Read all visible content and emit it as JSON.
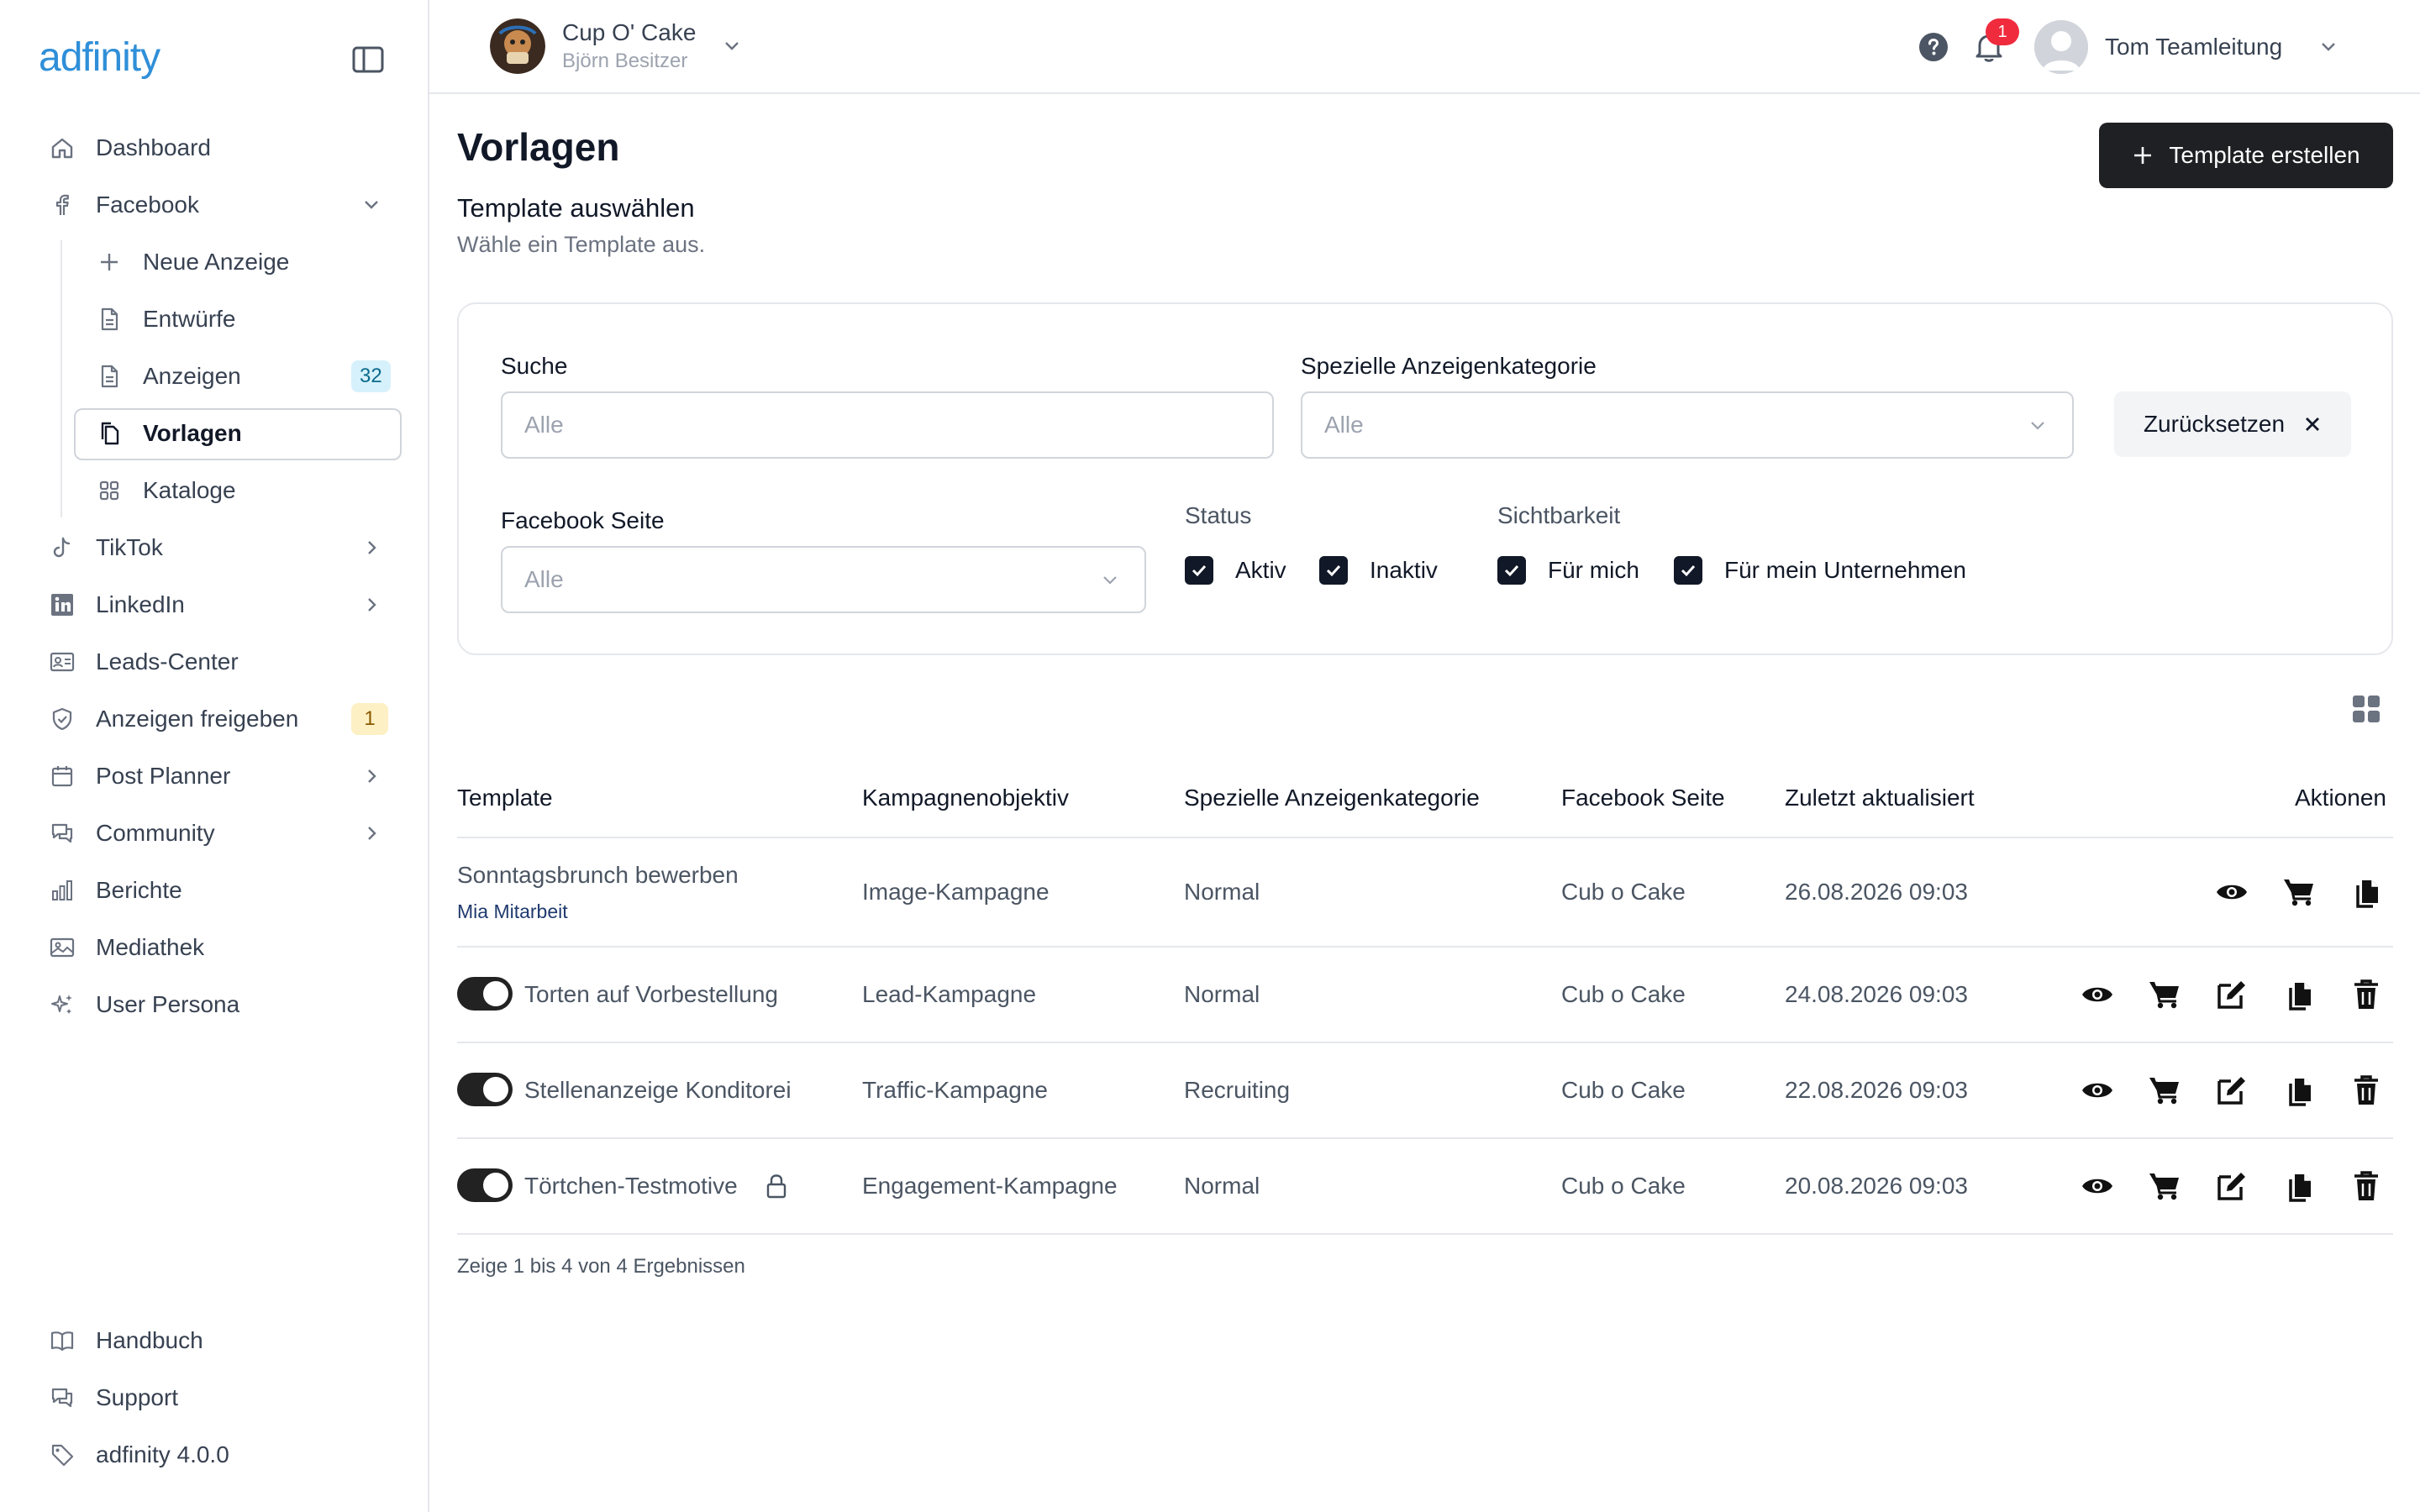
{
  "brand": {
    "logo_text": "adfinity",
    "accent": "#2f8fd8"
  },
  "sidebar": {
    "items": [
      {
        "label": "Dashboard",
        "icon": "home-icon"
      },
      {
        "label": "Facebook",
        "icon": "facebook-icon"
      },
      {
        "label": "Neue Anzeige",
        "icon": "plus-icon"
      },
      {
        "label": "Entwürfe",
        "icon": "document-icon"
      },
      {
        "label": "Anzeigen",
        "icon": "document-icon",
        "badge": "32"
      },
      {
        "label": "Vorlagen",
        "icon": "copy-icon"
      },
      {
        "label": "Kataloge",
        "icon": "grid-icon"
      },
      {
        "label": "TikTok",
        "icon": "tiktok-icon"
      },
      {
        "label": "LinkedIn",
        "icon": "linkedin-icon"
      },
      {
        "label": "Leads-Center",
        "icon": "id-card-icon"
      },
      {
        "label": "Anzeigen freigeben",
        "icon": "shield-check-icon",
        "badge": "1"
      },
      {
        "label": "Post Planner",
        "icon": "calendar-icon"
      },
      {
        "label": "Community",
        "icon": "chat-icon"
      },
      {
        "label": "Berichte",
        "icon": "bar-chart-icon"
      },
      {
        "label": "Mediathek",
        "icon": "image-icon"
      },
      {
        "label": "User Persona",
        "icon": "sparkles-icon"
      }
    ],
    "bottom": [
      {
        "label": "Handbuch",
        "icon": "book-icon"
      },
      {
        "label": "Support",
        "icon": "chat-icon"
      },
      {
        "label": "adfinity 4.0.0",
        "icon": "tag-icon"
      }
    ]
  },
  "topbar": {
    "company_name": "Cup O' Cake",
    "company_user": "Björn Besitzer",
    "notification_count": "1",
    "user_name": "Tom Teamleitung"
  },
  "page": {
    "title": "Vorlagen",
    "subtitle": "Template auswählen",
    "description": "Wähle ein Template aus.",
    "create_button": "Template erstellen"
  },
  "filters": {
    "search_label": "Suche",
    "search_placeholder": "Alle",
    "category_label": "Spezielle Anzeigenkategorie",
    "category_value": "Alle",
    "reset_label": "Zurücksetzen",
    "page_label": "Facebook Seite",
    "page_value": "Alle",
    "status_label": "Status",
    "status_active": "Aktiv",
    "status_inactive": "Inaktiv",
    "visibility_label": "Sichtbarkeit",
    "visibility_me": "Für mich",
    "visibility_company": "Für mein Unternehmen"
  },
  "table": {
    "headers": [
      "Template",
      "Kampagnenobjektiv",
      "Spezielle Anzeigenkategorie",
      "Facebook Seite",
      "Zuletzt aktualisiert",
      "Aktionen"
    ],
    "rows": [
      {
        "name": "Sonntagsbrunch bewerben",
        "owner": "Mia Mitarbeit",
        "objective": "Image-Kampagne",
        "category": "Normal",
        "page": "Cub o Cake",
        "updated": "26.08.2026 09:03"
      },
      {
        "name": "Torten auf Vorbestellung",
        "objective": "Lead-Kampagne",
        "category": "Normal",
        "page": "Cub o Cake",
        "updated": "24.08.2026 09:03"
      },
      {
        "name": "Stellenanzeige Konditorei",
        "objective": "Traffic-Kampagne",
        "category": "Recruiting",
        "page": "Cub o Cake",
        "updated": "22.08.2026 09:03"
      },
      {
        "name": "Törtchen-Testmotive",
        "objective": "Engagement-Kampagne",
        "category": "Normal",
        "page": "Cub o Cake",
        "updated": "20.08.2026 09:03"
      }
    ],
    "footer": "Zeige 1 bis 4 von 4 Ergebnissen"
  }
}
